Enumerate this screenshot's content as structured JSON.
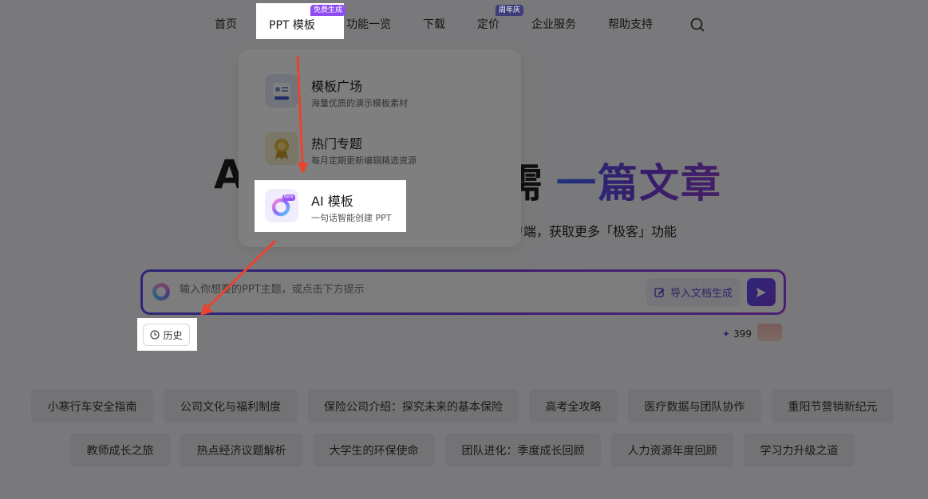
{
  "nav": {
    "items": [
      "首页",
      "PPT 模板",
      "功能一览",
      "下载",
      "定价",
      "企业服务",
      "帮助支持"
    ],
    "ppt_badge": "免费生成",
    "pricing_badge": "周年庆"
  },
  "hero": {
    "title_left": "A",
    "title_mid": "需",
    "title_accent": "一篇文章",
    "subtitle": "户端，获取更多「极客」功能"
  },
  "dropdown": {
    "items": [
      {
        "title": "模板广场",
        "desc": "海量优质的演示模板素材",
        "icon": "template-square-icon"
      },
      {
        "title": "热门专题",
        "desc": "每月定期更新编辑精选资源",
        "icon": "medal-icon"
      },
      {
        "title": "AI 模板",
        "desc": "一句话智能创建 PPT",
        "icon": "ai-ring-icon",
        "badge": "Beta"
      }
    ]
  },
  "prompt": {
    "placeholder": "输入你想要的PPT主题，或点击下方提示",
    "import_label": "导入文档生成"
  },
  "history_label": "历史",
  "credits": "399",
  "chips_row1": [
    "小寒行车安全指南",
    "公司文化与福利制度",
    "保险公司介绍：探究未来的基本保险",
    "高考全攻略",
    "医疗数据与团队协作",
    "重阳节营销新纪元"
  ],
  "chips_row2": [
    "教师成长之旅",
    "热点经济议题解析",
    "大学生的环保使命",
    "团队进化：季度成长回顾",
    "人力资源年度回顾",
    "学习力升级之道"
  ],
  "colors": {
    "accent": "#6a3bd6",
    "arrow": "#e8442e",
    "badge_purple": "#8f4cf0",
    "badge_blue": "#5566e8"
  }
}
